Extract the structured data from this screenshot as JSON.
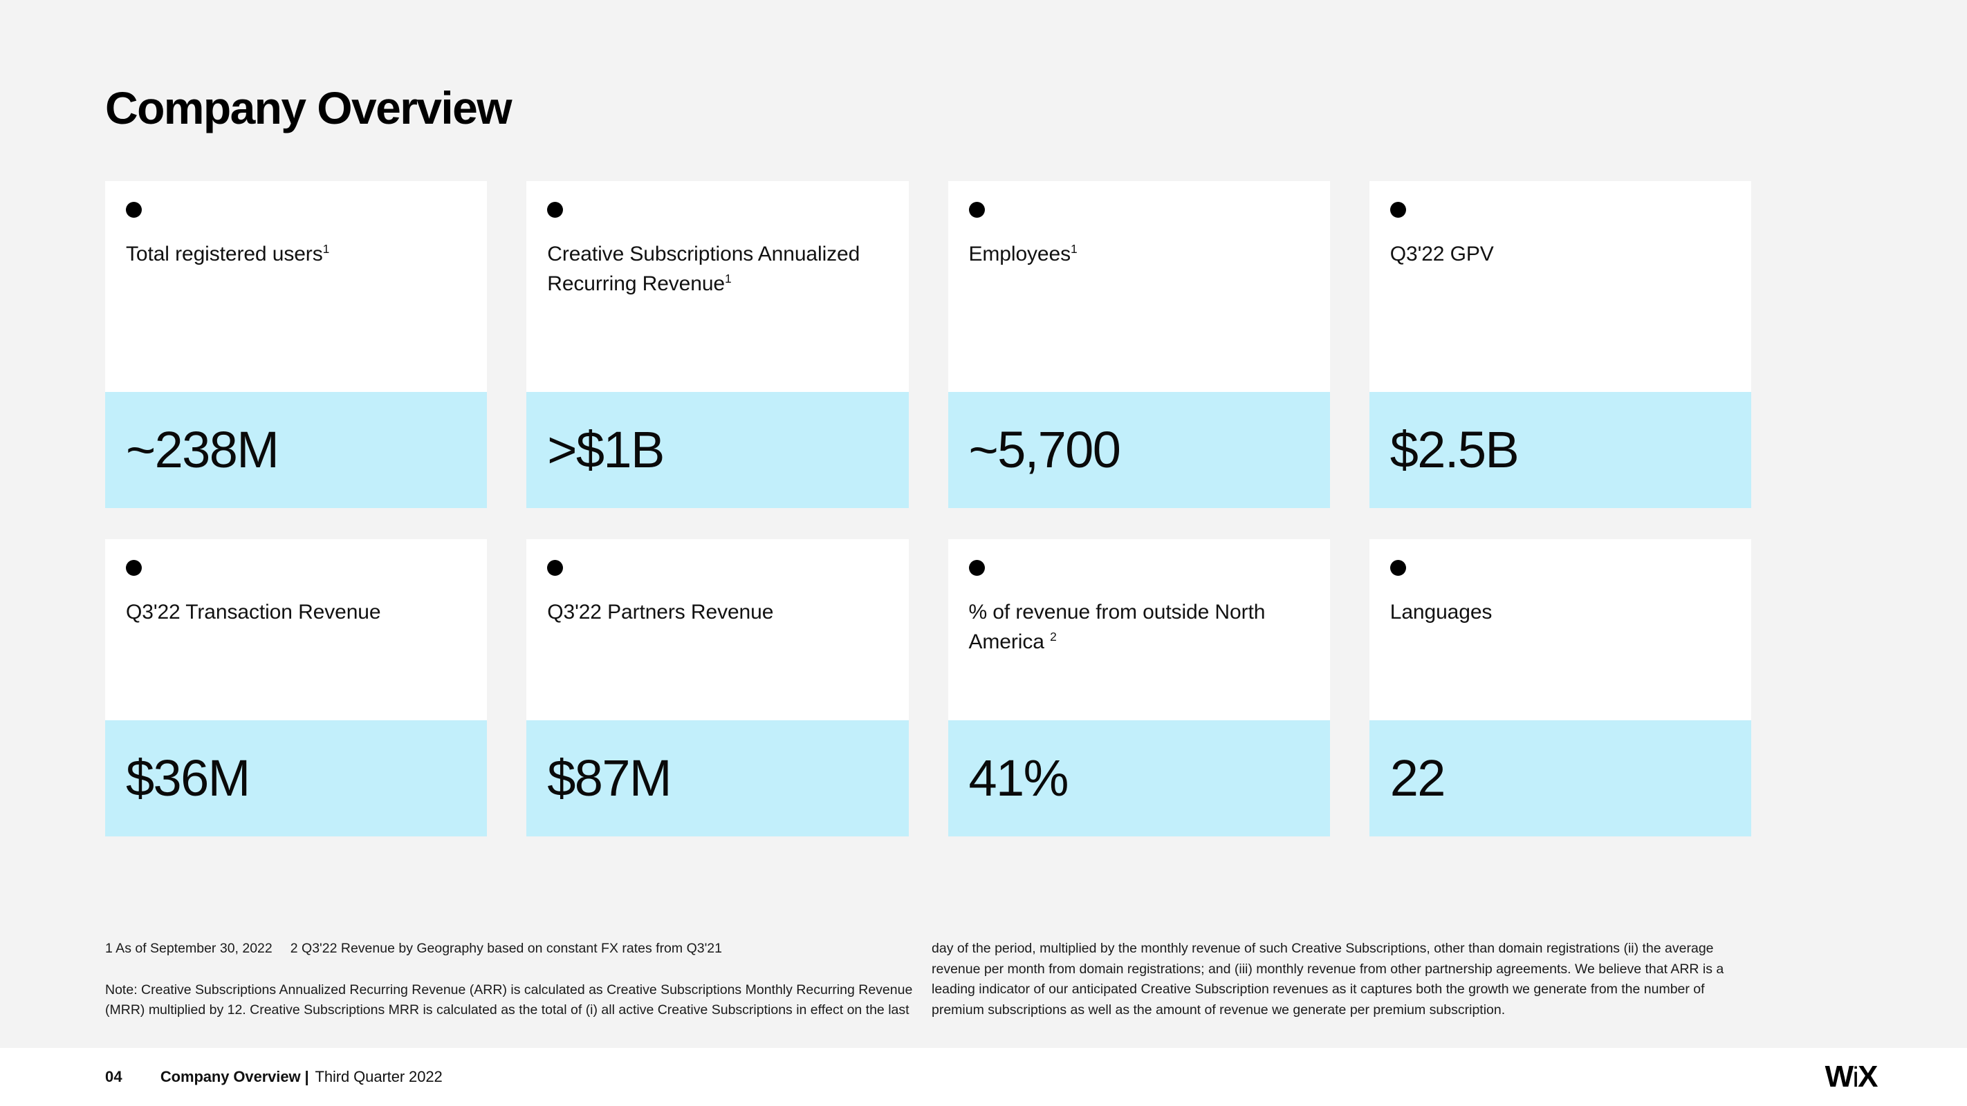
{
  "slide": {
    "title": "Company Overview",
    "background_color": "#f3f3f3",
    "card_color": "#ffffff",
    "value_band_color": "#c2effb"
  },
  "cards": [
    {
      "label": "Total registered users",
      "sup": "1",
      "value": "~238M"
    },
    {
      "label": "Creative Subscriptions Annualized Recurring Revenue",
      "sup": "1",
      "value": ">$1B"
    },
    {
      "label": "Employees",
      "sup": "1",
      "value": "~5,700"
    },
    {
      "label": "Q3'22 GPV",
      "sup": "",
      "value": "$2.5B"
    },
    {
      "label": "Q3'22 Transaction Revenue",
      "sup": "",
      "value": "$36M"
    },
    {
      "label": "Q3'22 Partners Revenue",
      "sup": "",
      "value": "$87M"
    },
    {
      "label": "% of revenue from outside North America ",
      "sup": "2",
      "value": "41%"
    },
    {
      "label": "Languages",
      "sup": "",
      "value": "22"
    }
  ],
  "footnotes": {
    "ref1": "1 As of September 30, 2022",
    "ref2": "2 Q3'22 Revenue by Geography based on constant FX rates from Q3'21",
    "note_left": "Note: Creative Subscriptions Annualized Recurring Revenue (ARR) is calculated as Creative Subscriptions Monthly Recurring Revenue (MRR) multiplied by 12. Creative Subscriptions MRR is calculated as the total of (i) all active Creative Subscriptions in effect on the last",
    "note_right": "day of the period, multiplied by the monthly revenue of such Creative Subscriptions, other than domain registrations (ii) the average revenue per month from domain registrations; and (iii) monthly revenue from other partnership agreements. We believe that ARR is a leading indicator of our anticipated Creative Subscription revenues as it captures both the growth we generate from the number of premium subscriptions as well as the amount of revenue we generate per premium subscription."
  },
  "footer": {
    "page_number": "04",
    "deck_name": "Company Overview |",
    "quarter": "Third Quarter 2022",
    "logo": {
      "w": "W",
      "i": "i",
      "x": "X"
    }
  }
}
